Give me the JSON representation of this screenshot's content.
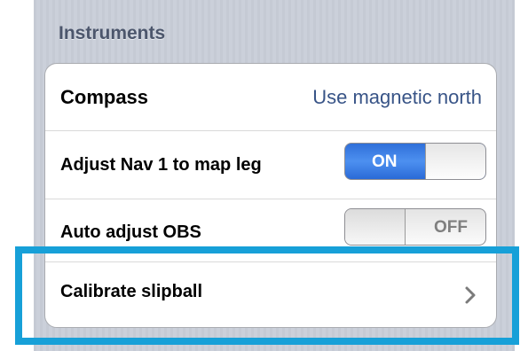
{
  "section": {
    "title": "Instruments"
  },
  "rows": {
    "compass": {
      "label": "Compass",
      "value": "Use magnetic north"
    },
    "adjust_nav": {
      "label": "Adjust Nav 1 to map leg",
      "toggle_state": "ON"
    },
    "auto_obs": {
      "label": "Auto adjust OBS",
      "toggle_state": "OFF"
    },
    "calibrate": {
      "label": "Calibrate slipball",
      "icon": "chevron-right-icon"
    }
  },
  "colors": {
    "background": "#c7ccd6",
    "header_text": "#4c566c",
    "value_text": "#385487",
    "toggle_on": "#3a7fe6",
    "highlight": "#17a0d8"
  }
}
